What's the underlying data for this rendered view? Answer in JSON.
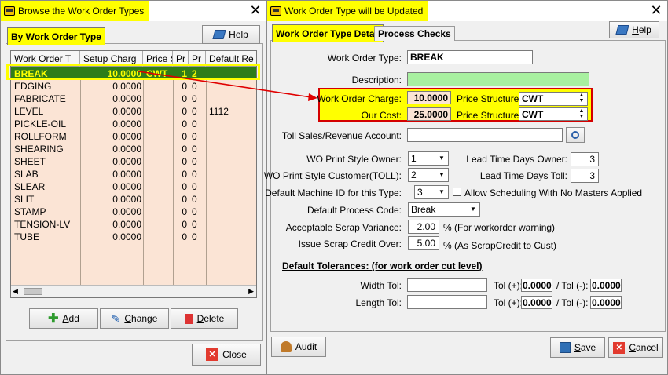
{
  "left_window": {
    "title": "Browse the Work Order Types",
    "tab_label": "By Work Order Type",
    "help_label": "Help",
    "columns": [
      "Work Order T",
      "Setup Charg",
      "Price S",
      "Pr",
      "Pr",
      "Default Re"
    ],
    "rows": [
      {
        "type": "BREAK",
        "setup": "10.0000",
        "price": "CWT",
        "pr1": "1",
        "pr2": "2",
        "def": ""
      },
      {
        "type": "EDGING",
        "setup": "0.0000",
        "price": "",
        "pr1": "0",
        "pr2": "0",
        "def": ""
      },
      {
        "type": "FABRICATE",
        "setup": "0.0000",
        "price": "",
        "pr1": "0",
        "pr2": "0",
        "def": ""
      },
      {
        "type": "LEVEL",
        "setup": "0.0000",
        "price": "",
        "pr1": "0",
        "pr2": "0",
        "def": "1112"
      },
      {
        "type": "PICKLE-OIL",
        "setup": "0.0000",
        "price": "",
        "pr1": "0",
        "pr2": "0",
        "def": ""
      },
      {
        "type": "ROLLFORM",
        "setup": "0.0000",
        "price": "",
        "pr1": "0",
        "pr2": "0",
        "def": ""
      },
      {
        "type": "SHEARING",
        "setup": "0.0000",
        "price": "",
        "pr1": "0",
        "pr2": "0",
        "def": ""
      },
      {
        "type": "SHEET",
        "setup": "0.0000",
        "price": "",
        "pr1": "0",
        "pr2": "0",
        "def": ""
      },
      {
        "type": "SLAB",
        "setup": "0.0000",
        "price": "",
        "pr1": "0",
        "pr2": "0",
        "def": ""
      },
      {
        "type": "SLEAR",
        "setup": "0.0000",
        "price": "",
        "pr1": "0",
        "pr2": "0",
        "def": ""
      },
      {
        "type": "SLIT",
        "setup": "0.0000",
        "price": "",
        "pr1": "0",
        "pr2": "0",
        "def": ""
      },
      {
        "type": "STAMP",
        "setup": "0.0000",
        "price": "",
        "pr1": "0",
        "pr2": "0",
        "def": ""
      },
      {
        "type": "TENSION-LV",
        "setup": "0.0000",
        "price": "",
        "pr1": "0",
        "pr2": "0",
        "def": ""
      },
      {
        "type": "TUBE",
        "setup": "0.0000",
        "price": "",
        "pr1": "0",
        "pr2": "0",
        "def": ""
      }
    ],
    "add_label": "Add",
    "change_label": "Change",
    "delete_label": "Delete",
    "close_label": "Close"
  },
  "right_window": {
    "title": "Work Order Type will be Updated",
    "tab_detail": "Work Order Type Detail",
    "tab_process": "Process Checks",
    "help_label": "Help",
    "work_order_type_label": "Work Order Type:",
    "work_order_type_value": "BREAK",
    "description_label": "Description:",
    "description_value": "",
    "wo_charge_label": "Work Order Charge:",
    "wo_charge_value": "10.0000",
    "price_structure_label": "Price Structure:",
    "price_structure_value": "CWT",
    "our_cost_label": "Our Cost:",
    "our_cost_value": "25.0000",
    "price_structure2_label": "Price Structure:",
    "price_structure2_value": "CWT",
    "toll_label": "Toll Sales/Revenue Account:",
    "toll_value": "",
    "wo_print_owner_label": "WO Print Style Owner:",
    "wo_print_owner_value": "1",
    "wo_print_cust_label": "WO Print Style Customer(TOLL):",
    "wo_print_cust_value": "2",
    "lead_owner_label": "Lead Time Days Owner:",
    "lead_owner_value": "3",
    "lead_toll_label": "Lead Time Days Toll:",
    "lead_toll_value": "3",
    "default_machine_label": "Default Machine ID for this Type:",
    "default_machine_value": "3",
    "allow_scheduling_label": "Allow Scheduling With No Masters Applied",
    "default_process_label": "Default Process Code:",
    "default_process_value": "Break",
    "scrap_variance_label": "Acceptable Scrap Variance:",
    "scrap_variance_value": "2.00",
    "scrap_variance_note": "%  (For workorder warning)",
    "scrap_credit_label": "Issue Scrap Credit Over:",
    "scrap_credit_value": "5.00",
    "scrap_credit_note": "%  (As ScrapCredit to Cust)",
    "tolerances_heading": "Default Tolerances:  (for work order cut level)",
    "width_tol_label": "Width Tol:",
    "length_tol_label": "Length Tol:",
    "tol_plus_label": "Tol (+):",
    "tol_minus_label": "/ Tol (-):",
    "width_tol_plus": "0.0000",
    "width_tol_minus": "0.0000",
    "length_tol_plus": "0.0000",
    "length_tol_minus": "0.0000",
    "audit_label": "Audit",
    "save_label": "Save",
    "cancel_label": "Cancel"
  },
  "colors": {
    "highlight_yellow": "#ffff00",
    "selected_row": "#2e7d19",
    "grid_bg": "#fbe4d5",
    "description_green": "#a8f0a0",
    "arrow_red": "#e00000"
  }
}
